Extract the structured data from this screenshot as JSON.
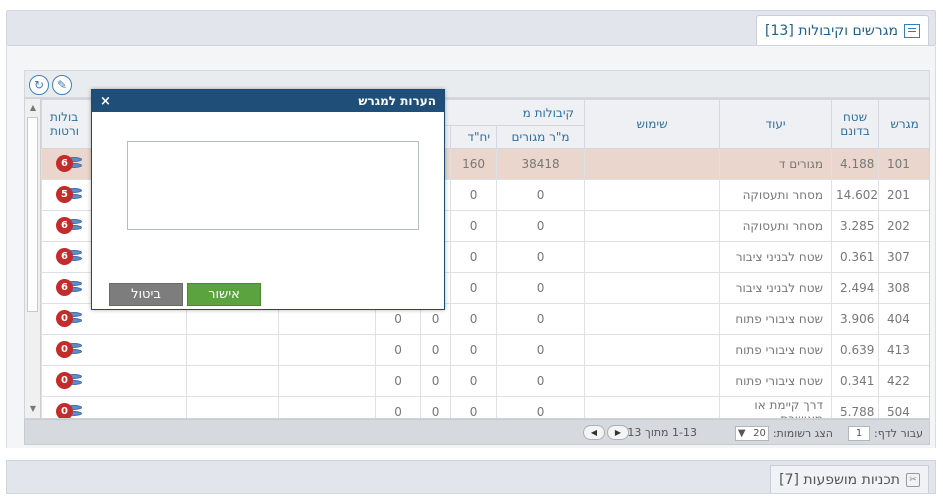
{
  "panel_title": "מגרשים וקיבולות [13]",
  "toolbar": {
    "refresh_icon": "refresh-icon",
    "edit_icon": "pencil-icon"
  },
  "table": {
    "headers": {
      "plot": "מגרש",
      "area_top": "שטח",
      "area_bottom": "בדונם",
      "designation": "יעוד",
      "use": "שימוש",
      "capacity_group": "קיבולות מ",
      "residential_sqm": "מ\"ר מגורים",
      "units": "יח\"ד",
      "capacities_top": "בולות",
      "capacities_bottom": "ורטות"
    },
    "rows": [
      {
        "plot": "101",
        "area": "4.188",
        "designation": "מגורים ד",
        "use": "",
        "sqm": "38418",
        "units": "160",
        "c1": "",
        "c2": "",
        "c3": "",
        "badge": "6"
      },
      {
        "plot": "201",
        "area": "14.602",
        "designation": "מסחר ותעסוקה",
        "use": "",
        "sqm": "0",
        "units": "0",
        "c1": "",
        "c2": "",
        "c3": "",
        "badge": "5"
      },
      {
        "plot": "202",
        "area": "3.285",
        "designation": "מסחר ותעסוקה",
        "use": "",
        "sqm": "0",
        "units": "0",
        "c1": "",
        "c2": "",
        "c3": "",
        "badge": "6"
      },
      {
        "plot": "307",
        "area": "0.361",
        "designation": "שטח לבניני ציבור",
        "use": "",
        "sqm": "0",
        "units": "0",
        "c1": "",
        "c2": "",
        "c3": "",
        "badge": "6"
      },
      {
        "plot": "308",
        "area": "2.494",
        "designation": "שטח לבניני ציבור",
        "use": "",
        "sqm": "0",
        "units": "0",
        "c1": "",
        "c2": "",
        "c3": "",
        "badge": "6"
      },
      {
        "plot": "404",
        "area": "3.906",
        "designation": "שטח ציבורי פתוח",
        "use": "",
        "sqm": "0",
        "units": "0",
        "c1": "0",
        "c2": "",
        "c3": "",
        "badge": "0"
      },
      {
        "plot": "413",
        "area": "0.639",
        "designation": "שטח ציבורי פתוח",
        "use": "",
        "sqm": "0",
        "units": "0",
        "c1": "0",
        "c2": "",
        "c3": "",
        "badge": "0"
      },
      {
        "plot": "422",
        "area": "0.341",
        "designation": "שטח ציבורי פתוח",
        "use": "",
        "sqm": "0",
        "units": "0",
        "c1": "0",
        "c2": "",
        "c3": "",
        "badge": "0"
      },
      {
        "plot": "504",
        "area": "5.788",
        "designation": "דרך קיימת או מאושרת",
        "use": "",
        "sqm": "0",
        "units": "0",
        "c1": "0",
        "c2": "",
        "c3": "",
        "badge": "0"
      }
    ],
    "extra_zero": "0"
  },
  "pager": {
    "goto_label": "עבור לדף:",
    "page": "1",
    "per_page_label": "הצג רשומות:",
    "per_page": "20",
    "range": "1-13 מתוך 13"
  },
  "bottom_panel_title": "תכניות מושפעות [7]",
  "modal": {
    "title": "הערות למגרש",
    "close": "×",
    "textarea_value": "",
    "ok": "אישור",
    "cancel": "ביטול"
  },
  "colors": {
    "highlight_row": "#ead6cc",
    "header_text": "#2f6fa0",
    "modal_title_bg": "#1f4f78",
    "ok_green": "#5aa33f",
    "badge_red": "#c42b2b"
  }
}
